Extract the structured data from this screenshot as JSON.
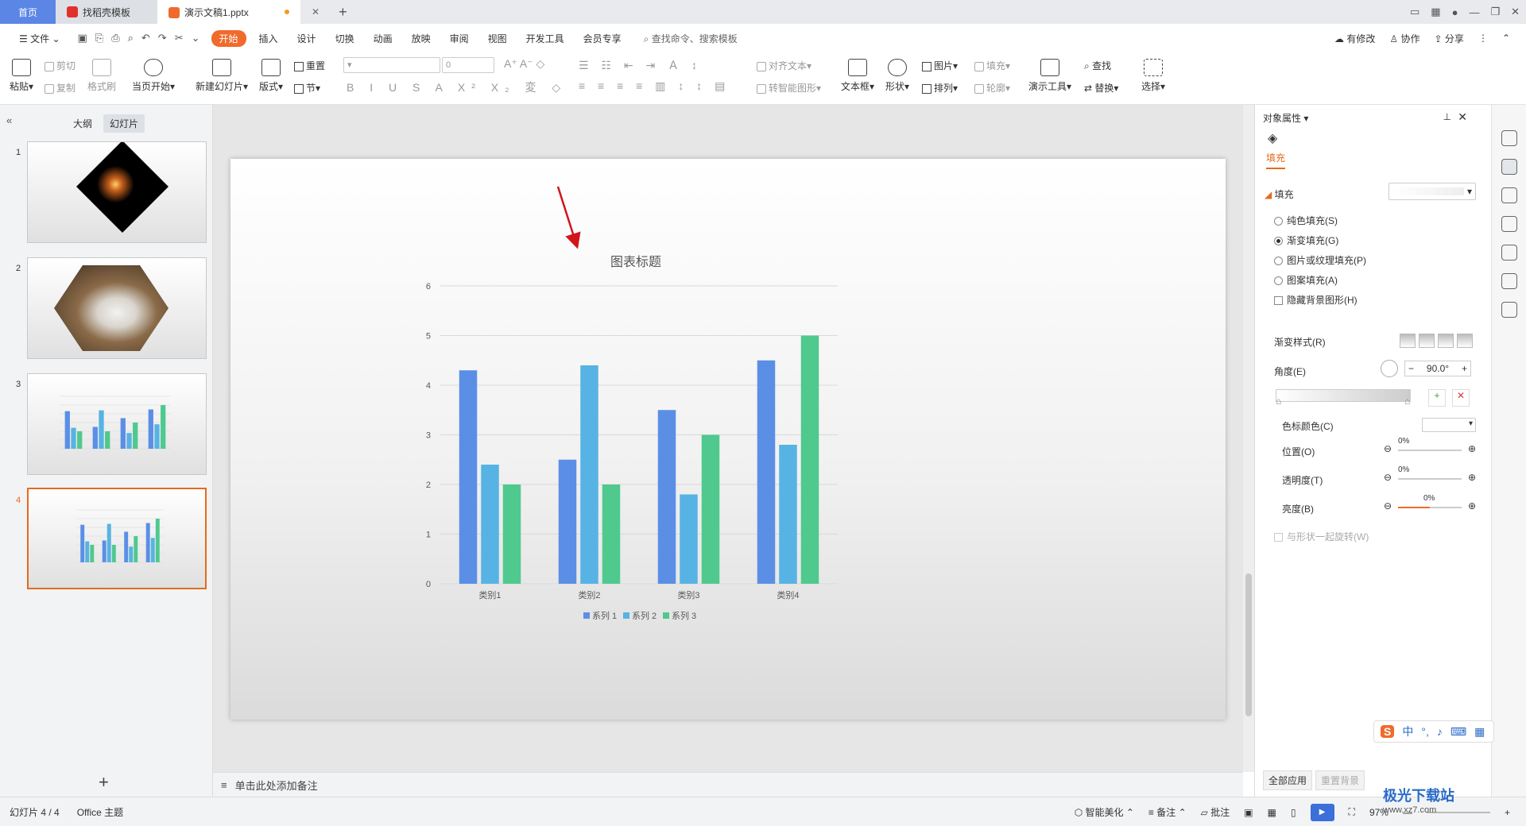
{
  "tabs": {
    "home": "首页",
    "templates": "找稻壳模板",
    "doc": "演示文稿1.pptx"
  },
  "menu": {
    "file": "文件",
    "items": [
      "开始",
      "插入",
      "设计",
      "切换",
      "动画",
      "放映",
      "审阅",
      "视图",
      "开发工具",
      "会员专享"
    ],
    "search": "查找命令、搜索模板",
    "modified": "有修改",
    "collab": "协作",
    "share": "分享"
  },
  "ribbon": {
    "paste": "粘贴",
    "cut": "剪切",
    "copy": "复制",
    "format_painter": "格式刷",
    "play_from_current": "当页开始",
    "new_slide": "新建幻灯片",
    "layout": "版式",
    "reset": "重置",
    "section": "节",
    "font_size": "0",
    "align_text": "对齐文本",
    "smartart": "转智能图形",
    "textbox": "文本框",
    "shape": "形状",
    "picture": "图片",
    "arrange": "排列",
    "fill": "填充",
    "outline": "轮廓",
    "presenter_tools": "演示工具",
    "find": "查找",
    "replace": "替换",
    "select": "选择"
  },
  "left_panel": {
    "outline_tab": "大纲",
    "slides_tab": "幻灯片",
    "slide_numbers": [
      "1",
      "2",
      "3",
      "4"
    ]
  },
  "notes_placeholder": "单击此处添加备注",
  "right_panel": {
    "title": "对象属性",
    "fill_tab": "填充",
    "fill_section": "填充",
    "options": [
      "纯色填充(S)",
      "渐变填充(G)",
      "图片或纹理填充(P)",
      "图案填充(A)"
    ],
    "selected_option": "渐变填充(G)",
    "hide_bg": "隐藏背景图形(H)",
    "gradient_style": "渐变样式(R)",
    "angle_label": "角度(E)",
    "angle_value": "90.0°",
    "stop_color": "色标颜色(C)",
    "position_label": "位置(O)",
    "position_value": "0%",
    "transparency_label": "透明度(T)",
    "transparency_value": "0%",
    "brightness_label": "亮度(B)",
    "brightness_value": "0%",
    "rotate_with_shape": "与形状一起旋转(W)",
    "apply_all": "全部应用",
    "reset_bg": "重置背景"
  },
  "status": {
    "slide_count": "幻灯片 4 / 4",
    "theme": "Office 主题",
    "beautify": "智能美化",
    "notes": "备注",
    "comments": "批注",
    "zoom": "97%"
  },
  "ime": {
    "lang": "中"
  },
  "watermark": {
    "brand": "极光下载站",
    "url": "www.xz7.com"
  },
  "colors": {
    "accent": "#f06a2c",
    "series1": "#5b8fe6",
    "series2": "#57b3e3",
    "series3": "#4fc98e"
  },
  "chart_data": {
    "type": "bar",
    "title": "图表标题",
    "categories": [
      "类别1",
      "类别2",
      "类别3",
      "类别4"
    ],
    "series": [
      {
        "name": "系列 1",
        "values": [
          4.3,
          2.5,
          3.5,
          4.5
        ]
      },
      {
        "name": "系列 2",
        "values": [
          2.4,
          4.4,
          1.8,
          2.8
        ]
      },
      {
        "name": "系列 3",
        "values": [
          2,
          2,
          3,
          5
        ]
      }
    ],
    "ylim": [
      0,
      6
    ],
    "yticks": [
      "0",
      "1",
      "2",
      "3",
      "4",
      "5",
      "6"
    ],
    "grid": true,
    "legend": "bottom"
  }
}
